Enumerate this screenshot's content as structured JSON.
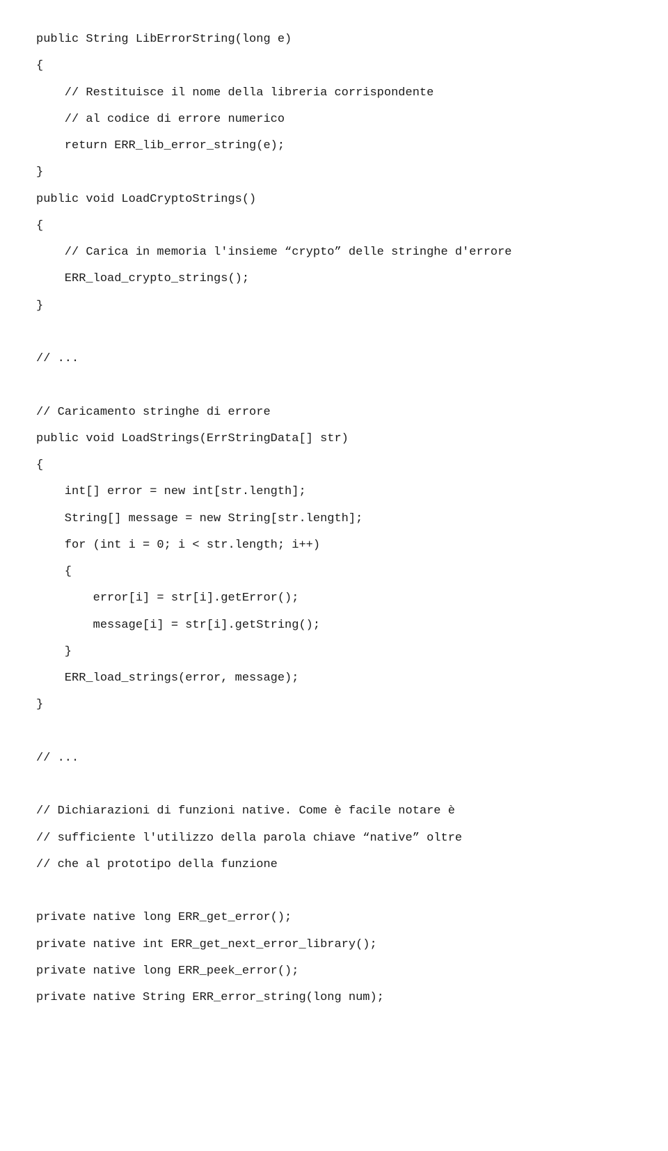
{
  "code": {
    "lines": [
      "public String LibErrorString(long e)",
      "{",
      "    // Restituisce il nome della libreria corrispondente",
      "    // al codice di errore numerico",
      "    return ERR_lib_error_string(e);",
      "}",
      "public void LoadCryptoStrings()",
      "{",
      "    // Carica in memoria l'insieme “crypto” delle stringhe d'errore",
      "    ERR_load_crypto_strings();",
      "}",
      "",
      "// ...",
      "",
      "// Caricamento stringhe di errore",
      "public void LoadStrings(ErrStringData[] str)",
      "{",
      "    int[] error = new int[str.length];",
      "    String[] message = new String[str.length];",
      "    for (int i = 0; i < str.length; i++)",
      "    {",
      "        error[i] = str[i].getError();",
      "        message[i] = str[i].getString();",
      "    }",
      "    ERR_load_strings(error, message);",
      "}",
      "",
      "// ...",
      "",
      "// Dichiarazioni di funzioni native. Come è facile notare è",
      "// sufficiente l'utilizzo della parola chiave “native” oltre",
      "// che al prototipo della funzione",
      "",
      "private native long ERR_get_error();",
      "private native int ERR_get_next_error_library();",
      "private native long ERR_peek_error();",
      "private native String ERR_error_string(long num);"
    ]
  }
}
